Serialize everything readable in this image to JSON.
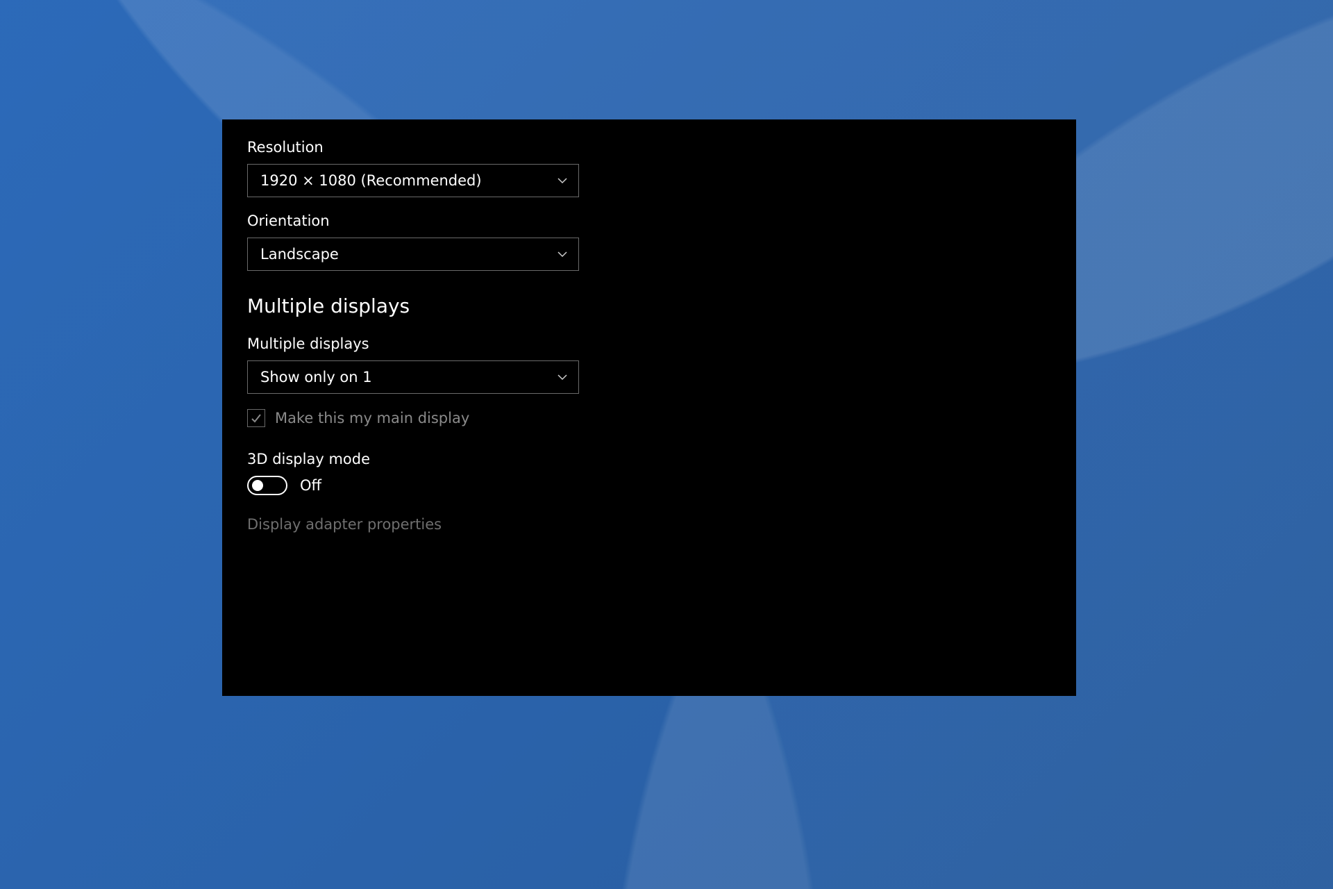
{
  "display": {
    "resolution": {
      "label": "Resolution",
      "value": "1920 × 1080 (Recommended)"
    },
    "orientation": {
      "label": "Orientation",
      "value": "Landscape"
    }
  },
  "multiple_displays": {
    "heading": "Multiple displays",
    "selector": {
      "label": "Multiple displays",
      "value": "Show only on 1"
    },
    "main_display_checkbox": {
      "label": "Make this my main display",
      "checked": true,
      "disabled": true
    }
  },
  "three_d": {
    "label": "3D display mode",
    "state": "Off"
  },
  "adapter_link": {
    "label": "Display adapter properties"
  }
}
